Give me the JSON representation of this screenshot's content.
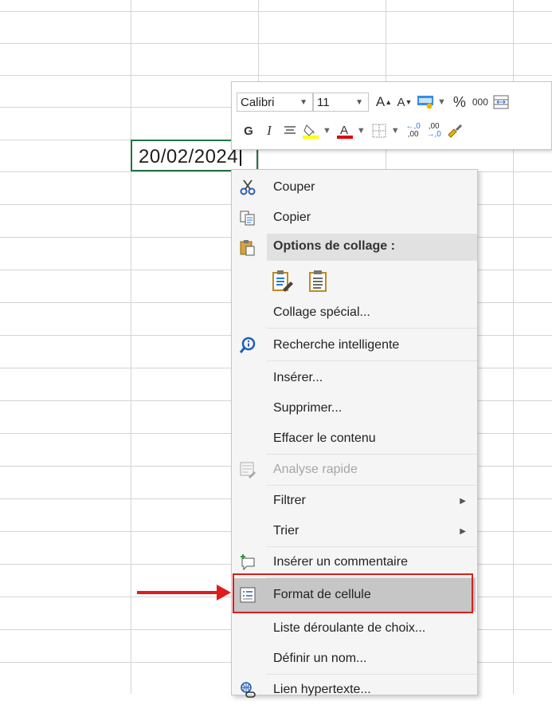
{
  "cell": {
    "value": "20/02/2024"
  },
  "mini_toolbar": {
    "font_name": "Calibri",
    "font_size": "11",
    "bold": "G",
    "italic": "I",
    "percent": "%",
    "thousands": "000",
    "increase_decimal": ",00",
    "decrease_decimal": ",00"
  },
  "menu": {
    "cut": "Couper",
    "copy": "Copier",
    "paste_options": "Options de collage :",
    "paste_special": "Collage spécial...",
    "smart_lookup": "Recherche intelligente",
    "insert": "Insérer...",
    "delete": "Supprimer...",
    "clear": "Effacer le contenu",
    "quick_analysis": "Analyse rapide",
    "filter": "Filtrer",
    "sort": "Trier",
    "insert_comment": "Insérer un commentaire",
    "format_cells": "Format de cellule",
    "dropdown_list": "Liste déroulante de choix...",
    "define_name": "Définir un nom...",
    "hyperlink": "Lien hypertexte..."
  },
  "colors": {
    "accent": "#217346",
    "highlight_red": "#e01b1b",
    "selected_bg": "#c6c6c6",
    "fill_yellow": "#ffff00",
    "font_red": "#e00000"
  }
}
